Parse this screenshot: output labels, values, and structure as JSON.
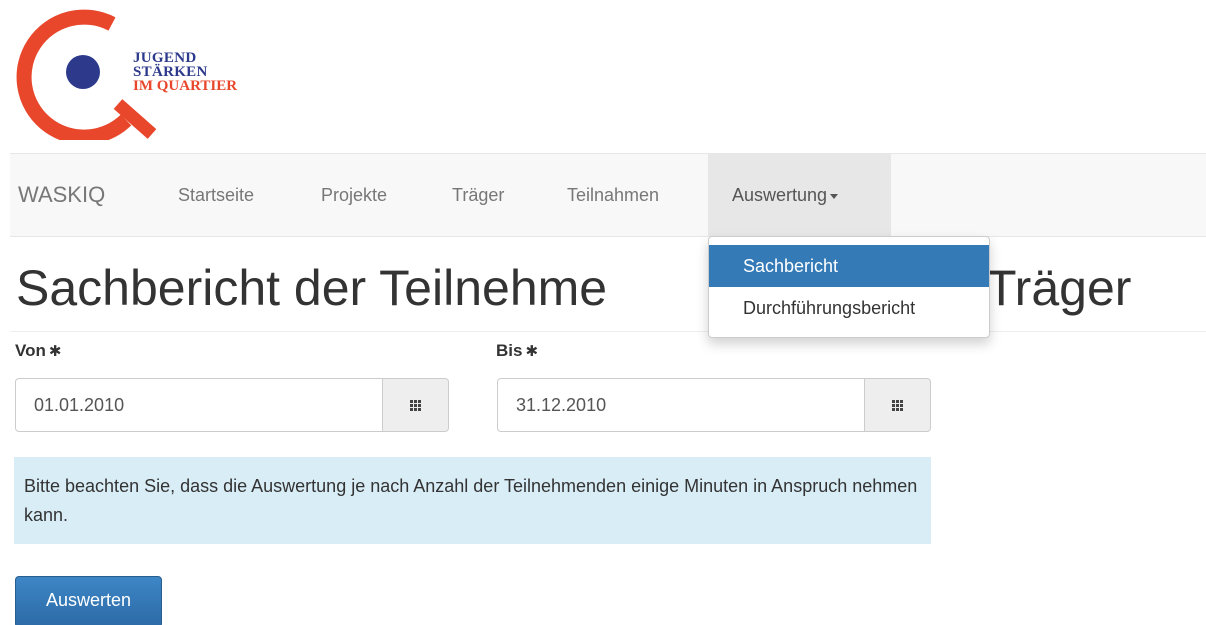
{
  "logo": {
    "line1": "JUGEND",
    "line2": "STÄRKEN",
    "line3": "IM QUARTIER",
    "colors": {
      "ring": "#e8472c",
      "dot": "#2d3a8c"
    }
  },
  "navbar": {
    "brand": "WASKIQ",
    "items": [
      {
        "label": "Startseite"
      },
      {
        "label": "Projekte"
      },
      {
        "label": "Träger"
      },
      {
        "label": "Teilnahmen"
      },
      {
        "label": "Auswertung"
      }
    ]
  },
  "dropdown": {
    "items": [
      {
        "label": "Sachbericht",
        "active": true
      },
      {
        "label": "Durchführungsbericht",
        "active": false
      }
    ]
  },
  "page": {
    "title_left": "Sachbericht der Teilnehme",
    "title_right": "Träger"
  },
  "form": {
    "from_label": "Von",
    "to_label": "Bis",
    "required_marker": "✱",
    "from_value": "01.01.2010",
    "to_value": "31.12.2010"
  },
  "alert": {
    "text": "Bitte beachten Sie, dass die Auswertung je nach Anzahl der Teilnehmenden einige Minuten in Anspruch nehmen kann."
  },
  "submit_label": "Auswerten",
  "colors": {
    "primary": "#337ab7",
    "alert_bg": "#d9edf7"
  }
}
